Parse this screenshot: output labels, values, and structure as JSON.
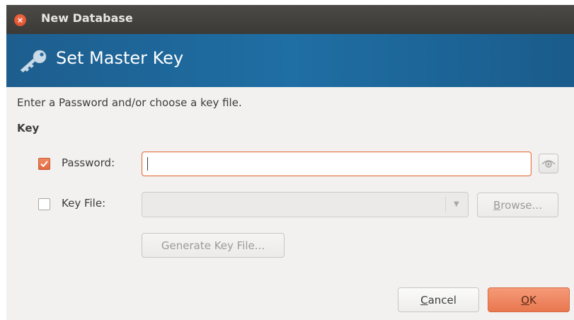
{
  "window": {
    "title": "New Database"
  },
  "banner": {
    "title": "Set Master Key",
    "icon": "key-icon"
  },
  "form": {
    "intro": "Enter a Password and/or choose a key file.",
    "section_label": "Key",
    "password": {
      "checked": true,
      "label": "Password:",
      "value": ""
    },
    "key_file": {
      "checked": false,
      "label": "Key File:",
      "selected": "",
      "browse_label_mnemonic": "B",
      "browse_label_rest": "rowse..."
    },
    "generate_label": "Generate Key File..."
  },
  "buttons": {
    "cancel_mnemonic": "C",
    "cancel_rest": "ancel",
    "ok_mnemonic": "O",
    "ok_rest": "K"
  },
  "colors": {
    "banner": "#1f6ea4",
    "accent": "#e8774f",
    "titlebar": "#3c3b37"
  }
}
